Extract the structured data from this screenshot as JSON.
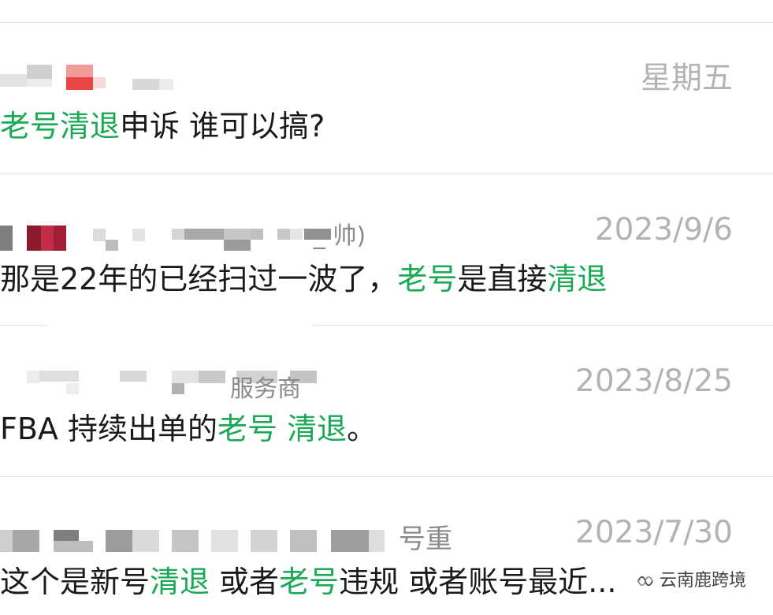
{
  "conversations": [
    {
      "sender_partial": "",
      "timestamp": "星期五",
      "message_segments": [
        {
          "text": "老号清退",
          "highlight": true
        },
        {
          "text": "申诉  谁可以搞?",
          "highlight": false
        }
      ]
    },
    {
      "sender_partial": "_ 帅)",
      "timestamp": "2023/9/6",
      "message_segments": [
        {
          "text": "那是22年的已经扫过一波了，",
          "highlight": false
        },
        {
          "text": "老号",
          "highlight": true
        },
        {
          "text": "是直接",
          "highlight": false
        },
        {
          "text": "清退",
          "highlight": true
        }
      ]
    },
    {
      "sender_partial": "服务商",
      "timestamp": "2023/8/25",
      "message_segments": [
        {
          "text": "FBA 持续出单的",
          "highlight": false
        },
        {
          "text": "老号 清退",
          "highlight": true
        },
        {
          "text": "。",
          "highlight": false
        }
      ]
    },
    {
      "sender_partial": "号重",
      "timestamp": "2023/7/30",
      "message_segments": [
        {
          "text": "这个是新号",
          "highlight": false
        },
        {
          "text": "清退",
          "highlight": true
        },
        {
          "text": " 或者",
          "highlight": false
        },
        {
          "text": "老号",
          "highlight": true
        },
        {
          "text": "违规 或者账号最近...",
          "highlight": false
        }
      ]
    }
  ],
  "watermark": {
    "text": "云南鹿跨境",
    "icon": "wechat-channel-icon"
  },
  "colors": {
    "highlight": "#1aaa55",
    "timestamp": "#b3b3b3",
    "text": "#1a1a1a",
    "divider": "#e6e6e6"
  }
}
